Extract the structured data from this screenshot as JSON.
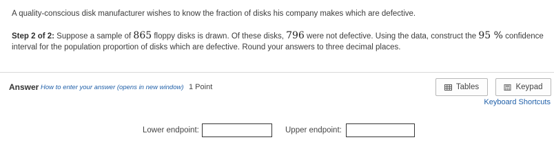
{
  "question": {
    "intro": "A quality-conscious disk manufacturer wishes to know the fraction of disks his company makes which are defective.",
    "step_label": "Step 2 of 2:",
    "text_1": " Suppose a sample of ",
    "sample_size": "865",
    "text_2": " floppy disks is drawn. Of these disks, ",
    "not_defective": "796",
    "text_3": " were not defective. Using the data, construct the ",
    "confidence": "95 %",
    "text_4": " confidence interval for the population proportion of disks which are defective. Round your answers to three decimal places."
  },
  "answer_bar": {
    "answer_label": "Answer",
    "how_to_link": "How to enter your answer (opens in new window)",
    "points": "1 Point",
    "tables_label": "Tables",
    "keypad_label": "Keypad",
    "shortcuts_label": "Keyboard Shortcuts"
  },
  "fields": {
    "lower_label": "Lower endpoint:",
    "lower_value": "",
    "upper_label": "Upper endpoint:",
    "upper_value": ""
  },
  "icons": {
    "tables": "table-grid-icon",
    "keypad": "calculator-icon"
  }
}
